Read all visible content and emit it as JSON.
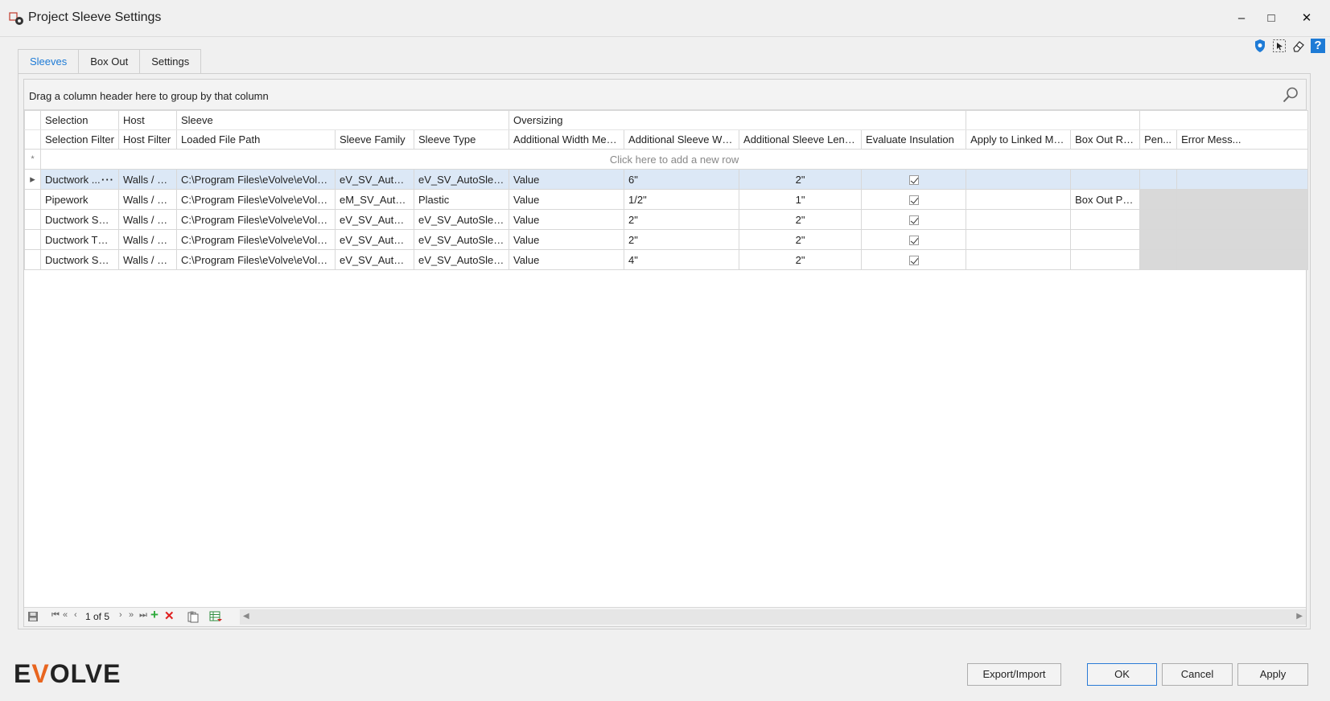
{
  "window": {
    "title": "Project Sleeve Settings",
    "minimize_glyph": "–",
    "maximize_glyph": "□",
    "close_glyph": "✕"
  },
  "toolbar_icons": [
    "shield-icon",
    "select-icon",
    "eraser-icon",
    "help-icon"
  ],
  "help_glyph": "?",
  "tabs": [
    {
      "label": "Sleeves",
      "active": true
    },
    {
      "label": "Box Out",
      "active": false
    },
    {
      "label": "Settings",
      "active": false
    }
  ],
  "grid": {
    "group_panel_text": "Drag a column header here to group by that column",
    "bands": [
      "Selection",
      "Host",
      "Sleeve",
      "Oversizing",
      "",
      ""
    ],
    "columns": [
      "Selection Filter",
      "Host Filter",
      "Loaded File Path",
      "Sleeve Family",
      "Sleeve Type",
      "Additional Width Method",
      "Additional Sleeve Width",
      "Additional Sleeve Length",
      "Evaluate Insulation",
      "Apply to Linked Model",
      "Box Out Rule",
      "Pen...",
      "Error Mess..."
    ],
    "new_row_text": "Click here to add a new row",
    "new_row_glyph": "*",
    "row_indicator_glyph": "▸",
    "ellipsis_glyph": "···",
    "rows": [
      {
        "selection_filter": "Ductwork ...",
        "host_filter": "Walls / Fl...",
        "loaded_file_path": "C:\\Program Files\\eVolve\\eVolve ...",
        "sleeve_family": "eV_SV_AutoSl...",
        "sleeve_type": "eV_SV_AutoSleev...",
        "width_method": "Value",
        "sleeve_width": "6\"",
        "sleeve_length": "2\"",
        "evaluate_insulation": true,
        "apply_linked": "",
        "box_out_rule": "",
        "pen": "",
        "error": ""
      },
      {
        "selection_filter": "Pipework",
        "host_filter": "Walls / Fl...",
        "loaded_file_path": "C:\\Program Files\\eVolve\\eVolve ...",
        "sleeve_family": "eM_SV_AutoS...",
        "sleeve_type": "Plastic",
        "width_method": "Value",
        "sleeve_width": "1/2\"",
        "sleeve_length": "1\"",
        "evaluate_insulation": true,
        "apply_linked": "",
        "box_out_rule": "Box Out Pipe",
        "pen": "",
        "error": ""
      },
      {
        "selection_filter": "Ductwork S&D...",
        "host_filter": "Walls / Fl...",
        "loaded_file_path": "C:\\Program Files\\eVolve\\eVolve ...",
        "sleeve_family": "eV_SV_AutoSl...",
        "sleeve_type": "eV_SV_AutoSleev...",
        "width_method": "Value",
        "sleeve_width": "2\"",
        "sleeve_length": "2\"",
        "evaluate_insulation": true,
        "apply_linked": "",
        "box_out_rule": "",
        "pen": "",
        "error": ""
      },
      {
        "selection_filter": "Ductwork TDC...",
        "host_filter": "Walls / Fl...",
        "loaded_file_path": "C:\\Program Files\\eVolve\\eVolve ...",
        "sleeve_family": "eV_SV_AutoSl...",
        "sleeve_type": "eV_SV_AutoSleev...",
        "width_method": "Value",
        "sleeve_width": "2\"",
        "sleeve_length": "2\"",
        "evaluate_insulation": true,
        "apply_linked": "",
        "box_out_rule": "",
        "pen": "",
        "error": ""
      },
      {
        "selection_filter": "Ductwork S&D...",
        "host_filter": "Walls / Fl...",
        "loaded_file_path": "C:\\Program Files\\eVolve\\eVolve ...",
        "sleeve_family": "eV_SV_AutoSl...",
        "sleeve_type": "eV_SV_AutoSleev...",
        "width_method": "Value",
        "sleeve_width": "4\"",
        "sleeve_length": "2\"",
        "evaluate_insulation": true,
        "apply_linked": "",
        "box_out_rule": "",
        "pen": "",
        "error": ""
      }
    ]
  },
  "navigator": {
    "first": "⏮",
    "prev_page": "«",
    "prev": "‹",
    "record_text": "1 of 5",
    "next": "›",
    "next_page": "»",
    "last": "⏭",
    "add": "+",
    "delete": "✕",
    "scroll_left": "◀",
    "scroll_right": "▶"
  },
  "brand": {
    "logo_pre": "E",
    "logo_v": "V",
    "logo_post": "OLVE",
    "accent": "#e8651f"
  },
  "buttons": {
    "export_import": "Export/Import",
    "ok": "OK",
    "cancel": "Cancel",
    "apply": "Apply"
  }
}
